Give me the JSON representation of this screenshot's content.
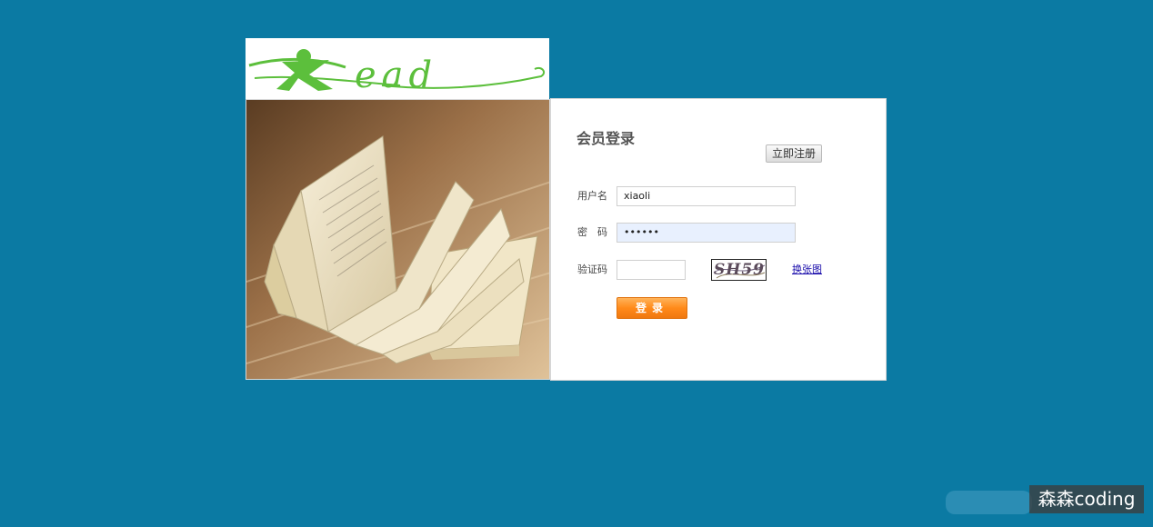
{
  "logo": {
    "text": "Read",
    "color": "#5cbf3c"
  },
  "login": {
    "title": "会员登录",
    "register_label": "立即注册",
    "username_label": "用户名",
    "username_value": "xiaoli",
    "password_label": "密　码",
    "password_value": "••••••",
    "captcha_label": "验证码",
    "captcha_value": "",
    "captcha_text": "SH59",
    "refresh_label": "换张图",
    "submit_label": "登录"
  },
  "watermark": {
    "text": "森森coding"
  },
  "colors": {
    "background": "#0b7aa3",
    "accent": "#ff8a1a",
    "logo_green": "#5cbf3c"
  }
}
